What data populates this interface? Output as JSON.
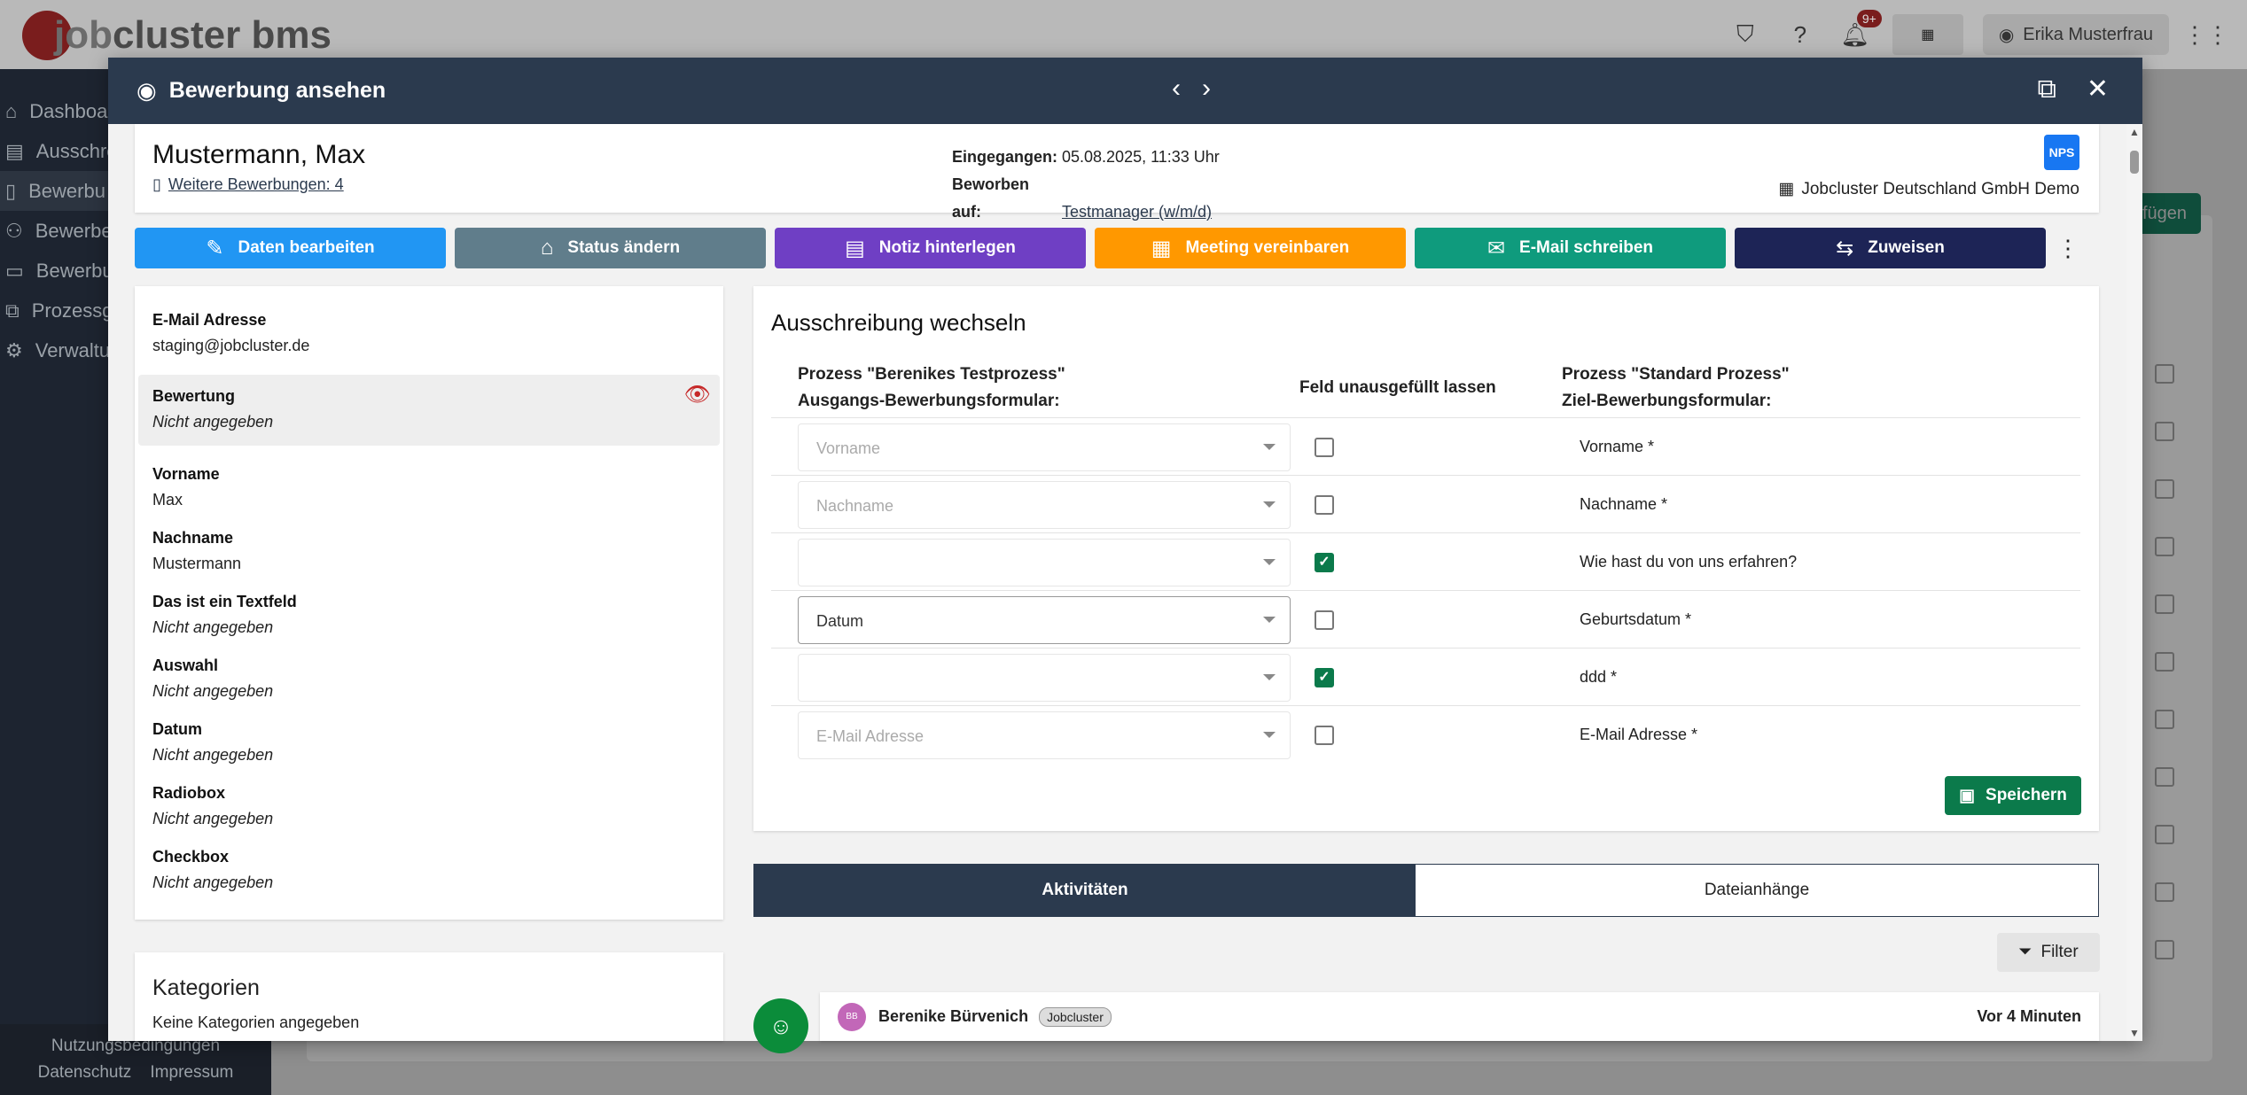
{
  "app": {
    "logo_prefix": "job",
    "logo_text": "cluster bms",
    "notifications_badge": "9+",
    "user_name": "Erika Musterfrau"
  },
  "sidebar": {
    "items": [
      {
        "label": "Dashboa",
        "icon": "home-icon"
      },
      {
        "label": "Ausschre",
        "icon": "document-list-icon"
      },
      {
        "label": "Bewerbu",
        "icon": "application-icon"
      },
      {
        "label": "Bewerbe",
        "icon": "people-icon"
      },
      {
        "label": "Bewerbu",
        "icon": "contact-card-icon"
      },
      {
        "label": "Prozessg",
        "icon": "process-icon"
      },
      {
        "label": "Verwaltu",
        "icon": "gear-icon"
      }
    ],
    "footer": {
      "terms": "Nutzungsbedingungen",
      "privacy": "Datenschutz",
      "imprint": "Impressum"
    }
  },
  "background": {
    "add_button": "fügen"
  },
  "modal": {
    "title": "Bewerbung ansehen",
    "applicant": {
      "name": "Mustermann, Max",
      "more_applications": "Weitere Bewerbungen: 4",
      "received_label": "Eingegangen:",
      "received_value": "05.08.2025, 11:33 Uhr",
      "applied_label": "Beworben auf:",
      "applied_value": "Testmanager (w/m/d)",
      "nps": "NPS",
      "company": "Jobcluster Deutschland GmbH Demo"
    },
    "actions": [
      {
        "label": "Daten bearbeiten",
        "icon": "✎",
        "color": "#2196f3"
      },
      {
        "label": "Status ändern",
        "icon": "⌂",
        "color": "#607d8b"
      },
      {
        "label": "Notiz hinterlegen",
        "icon": "▤",
        "color": "#6f3fc4"
      },
      {
        "label": "Meeting vereinbaren",
        "icon": "▦",
        "color": "#ff9800"
      },
      {
        "label": "E-Mail schreiben",
        "icon": "✉",
        "color": "#0f9b7d"
      },
      {
        "label": "Zuweisen",
        "icon": "⇆",
        "color": "#1d2456"
      }
    ],
    "details": [
      {
        "label": "E-Mail Adresse",
        "value": "staging@jobcluster.de",
        "empty": false
      },
      {
        "label": "Bewertung",
        "value": "Nicht angegeben",
        "empty": true,
        "highlight": true
      },
      {
        "label": "Vorname",
        "value": "Max",
        "empty": false
      },
      {
        "label": "Nachname",
        "value": "Mustermann",
        "empty": false
      },
      {
        "label": "Das ist ein Textfeld",
        "value": "Nicht angegeben",
        "empty": true
      },
      {
        "label": "Auswahl",
        "value": "Nicht angegeben",
        "empty": true
      },
      {
        "label": "Datum",
        "value": "Nicht angegeben",
        "empty": true
      },
      {
        "label": "Radiobox",
        "value": "Nicht angegeben",
        "empty": true
      },
      {
        "label": "Checkbox",
        "value": "Nicht angegeben",
        "empty": true
      }
    ],
    "categories": {
      "title": "Kategorien",
      "empty_text": "Keine Kategorien angegeben"
    },
    "switch": {
      "title": "Ausschreibung wechseln",
      "col_source_1": "Prozess \"Berenikes Testprozess\"",
      "col_source_2": "Ausgangs-Bewerbungsformular:",
      "col_skip": "Feld unausgefüllt lassen",
      "col_target_1": "Prozess \"Standard Prozess\"",
      "col_target_2": "Ziel-Bewerbungsformular:",
      "rows": [
        {
          "source": "Vorname",
          "active": false,
          "skip": false,
          "target": "Vorname *"
        },
        {
          "source": "Nachname",
          "active": false,
          "skip": false,
          "target": "Nachname *"
        },
        {
          "source": "",
          "active": false,
          "skip": true,
          "target": "Wie hast du von uns erfahren?"
        },
        {
          "source": "Datum",
          "active": true,
          "skip": false,
          "target": "Geburtsdatum *"
        },
        {
          "source": "",
          "active": false,
          "skip": true,
          "target": "ddd *"
        },
        {
          "source": "E-Mail Adresse",
          "active": false,
          "skip": false,
          "target": "E-Mail Adresse *"
        }
      ],
      "save_label": "Speichern"
    },
    "tabs": {
      "activities": "Aktivitäten",
      "attachments": "Dateianhänge"
    },
    "filter_label": "Filter",
    "activity": {
      "initials": "BB",
      "name": "Berenike Bürvenich",
      "tag": "Jobcluster",
      "time": "Vor 4 Minuten"
    }
  }
}
